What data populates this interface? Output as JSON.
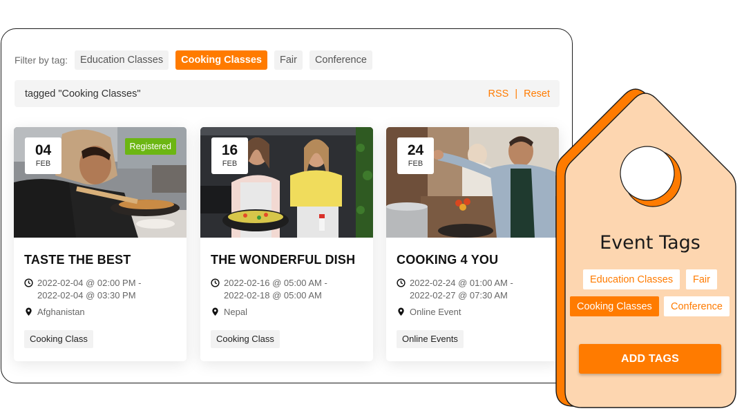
{
  "filter": {
    "label": "Filter by tag:",
    "tags": [
      {
        "label": "Education Classes",
        "active": false
      },
      {
        "label": "Cooking Classes",
        "active": true
      },
      {
        "label": "Fair",
        "active": false
      },
      {
        "label": "Conference",
        "active": false
      }
    ]
  },
  "tagged_bar": {
    "text": "tagged \"Cooking Classes\"",
    "rss_label": "RSS",
    "separator": "|",
    "reset_label": "Reset"
  },
  "events": [
    {
      "day": "04",
      "month": "FEB",
      "registered_label": "Registered",
      "title": "TASTE THE BEST",
      "time_start": "2022-02-04 @ 02:00 PM -",
      "time_end": "2022-02-04 @ 03:30 PM",
      "location": "Afghanistan",
      "tag": "Cooking Class",
      "photo": "woman-cooking-with-pan"
    },
    {
      "day": "16",
      "month": "FEB",
      "title": "THE WONDERFUL DISH",
      "time_start": "2022-02-16 @ 05:00 AM -",
      "time_end": "2022-02-18 @ 05:00 AM",
      "location": "Nepal",
      "tag": "Cooking Class",
      "photo": "two-women-cooking"
    },
    {
      "day": "24",
      "month": "FEB",
      "title": "COOKING 4 YOU",
      "time_start": "2022-02-24 @ 01:00 AM -",
      "time_end": "2022-02-27 @ 07:30 AM",
      "location": "Online Event",
      "tag": "Online Events",
      "photo": "man-cooking-in-kitchen"
    }
  ],
  "icons": {
    "time": "clock-icon",
    "location": "map-pin-icon"
  },
  "tag_panel": {
    "title": "Event Tags",
    "tags": [
      {
        "label": "Education Classes",
        "active": false
      },
      {
        "label": "Fair",
        "active": false
      },
      {
        "label": "Cooking Classes",
        "active": true
      },
      {
        "label": "Conference",
        "active": false
      }
    ],
    "button_label": "ADD TAGS"
  },
  "colors": {
    "accent": "#ff7b00",
    "registered": "#6cb613",
    "tag_fill": "#fdd6b0",
    "chip_bg": "#f2f2f2"
  }
}
